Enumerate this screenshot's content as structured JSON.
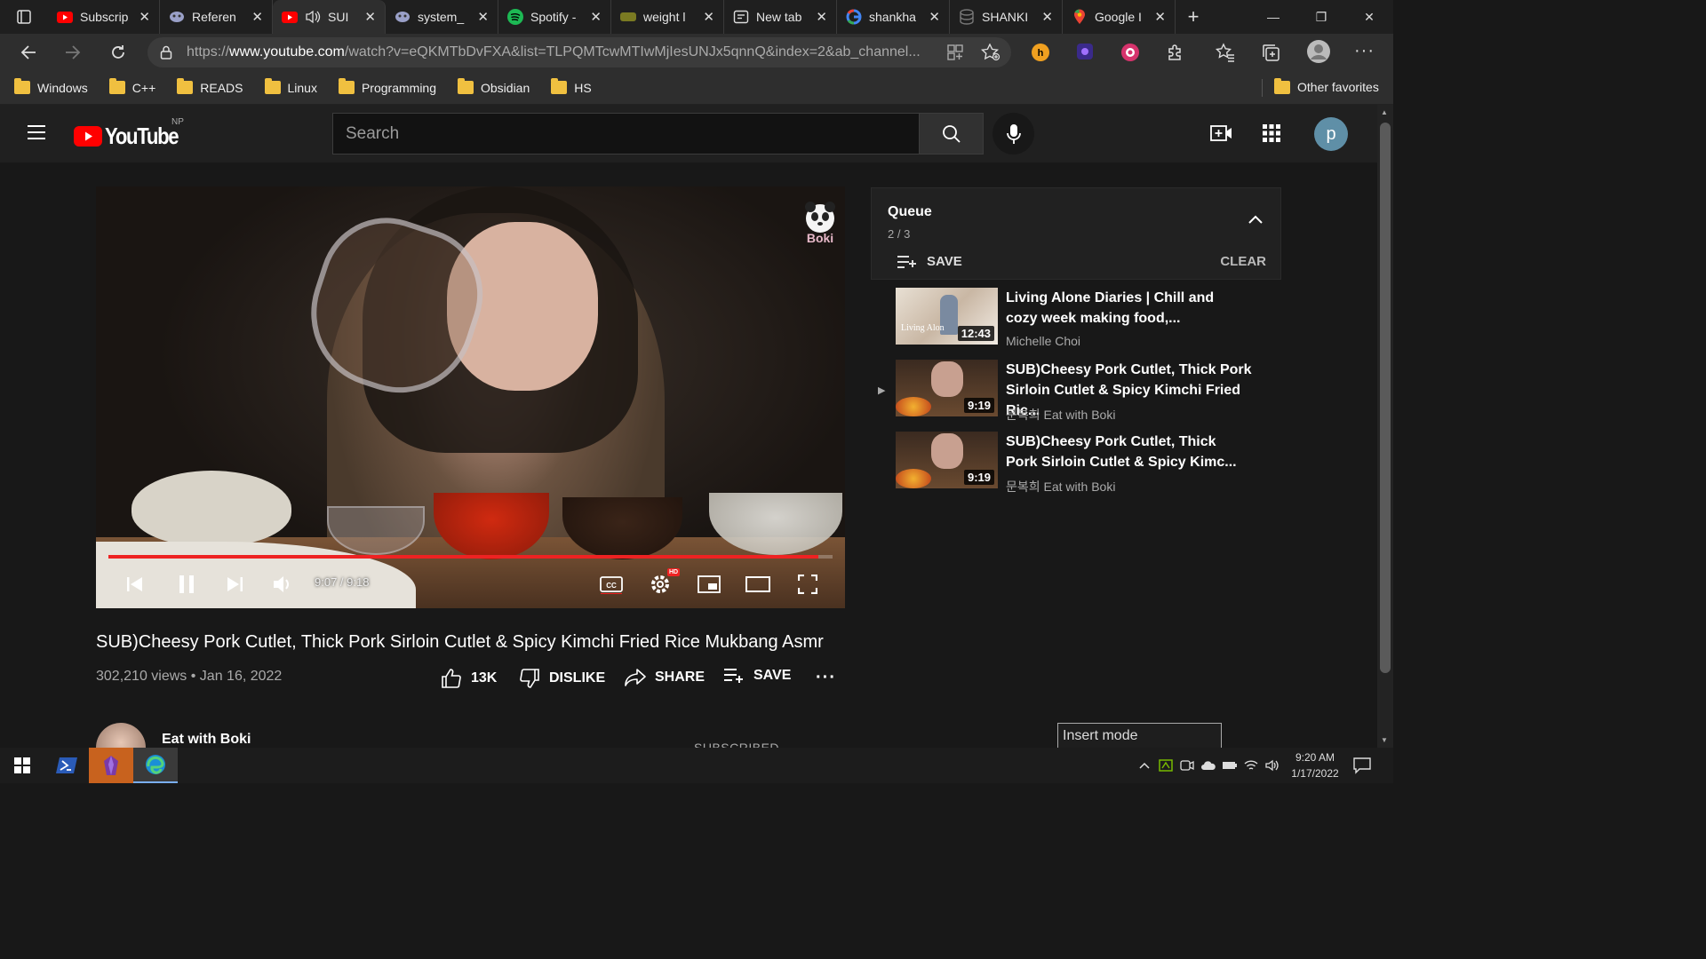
{
  "browser": {
    "tabs": [
      {
        "title": "Subscrip",
        "icon": "youtube-icon",
        "active": false
      },
      {
        "title": "Referen",
        "icon": "ghost-icon",
        "active": false
      },
      {
        "title": "SUI",
        "icon": "youtube-icon",
        "active": true,
        "audio": true
      },
      {
        "title": "system_",
        "icon": "ghost-icon",
        "active": false
      },
      {
        "title": "Spotify -",
        "icon": "spotify-icon",
        "active": false
      },
      {
        "title": "weight l",
        "icon": "tag-icon",
        "active": false
      },
      {
        "title": "New tab",
        "icon": "newtab-icon",
        "active": false
      },
      {
        "title": "shankha",
        "icon": "google-icon",
        "active": false
      },
      {
        "title": "SHANKI",
        "icon": "database-icon",
        "active": false
      },
      {
        "title": "Google I",
        "icon": "maps-pin-icon",
        "active": false
      }
    ],
    "url_prefix": "https://",
    "url_host": "www.youtube.com",
    "url_rest": "/watch?v=eQKMTbDvFXA&list=TLPQMTcwMTIwMjIesUNJx5qnnQ&index=2&ab_channel...",
    "bookmarks": [
      "Windows",
      "C++",
      "READS",
      "Linux",
      "Programming",
      "Obsidian",
      "HS"
    ],
    "other_favorites": "Other favorites"
  },
  "youtube": {
    "logo_text": "YouTube",
    "region": "NP",
    "search_placeholder": "Search",
    "avatar_letter": "p"
  },
  "player": {
    "time_current": "9:07",
    "time_total": "9:18",
    "progress": 0.98,
    "watermark": "Boki",
    "hd_badge": "HD"
  },
  "video": {
    "title": "SUB)Cheesy Pork Cutlet, Thick Pork Sirloin Cutlet & Spicy Kimchi Fried Rice Mukbang Asmr",
    "views": "302,210 views",
    "date": "Jan 16, 2022",
    "likes": "13K",
    "dislike_label": "DISLIKE",
    "share_label": "SHARE",
    "save_label": "SAVE",
    "channel": "Eat with Boki",
    "subscribe_label": "SUBSCRIBED"
  },
  "queue": {
    "title": "Queue",
    "count": "2 / 3",
    "save_label": "SAVE",
    "clear_label": "CLEAR",
    "items": [
      {
        "title_line1": "Living Alone Diaries | Chill and",
        "title_line2": "cozy week making food,...",
        "channel": "Michelle Choi",
        "duration": "12:43",
        "playing": false
      },
      {
        "title_line1": "SUB)Cheesy Pork Cutlet, Thick Pork",
        "title_line2": "Sirloin Cutlet & Spicy Kimchi Fried Ric...",
        "channel": "문복희 Eat with Boki",
        "duration": "9:19",
        "playing": true
      },
      {
        "title_line1": "SUB)Cheesy Pork Cutlet, Thick",
        "title_line2": "Pork Sirloin Cutlet & Spicy Kimc...",
        "channel": "문복희 Eat with Boki",
        "duration": "9:19",
        "playing": false
      }
    ]
  },
  "overlay": {
    "insert_mode": "Insert mode"
  },
  "taskbar": {
    "time": "9:20 AM",
    "date": "1/17/2022"
  },
  "colors": {
    "youtube_red": "#ff0000",
    "progress_red": "#e22222",
    "background": "#181818"
  }
}
